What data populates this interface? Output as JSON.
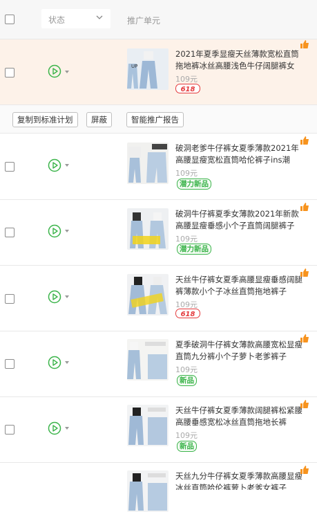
{
  "header": {
    "status_label": "状态",
    "unit_label": "推广单元"
  },
  "actions": {
    "copy_label": "复制到标准计划",
    "block_label": "屏蔽",
    "report_label": "智能推广报告"
  },
  "items": [
    {
      "title": "2021年夏季显瘦天丝薄款宽松直筒拖地裤冰丝高腰浅色牛仔阔腿裤女",
      "price": "109元",
      "badge": "618"
    },
    {
      "title": "破洞老爹牛仔裤女夏季薄款2021年高腰显瘦宽松直筒哈伦裤子ins潮",
      "price": "109元",
      "badge": "潜力新品"
    },
    {
      "title": "破洞牛仔裤夏季女薄款2021年新款高腰显瘦垂感小个子直筒阔腿裤子",
      "price": "109元",
      "badge": "潜力新品"
    },
    {
      "title": "天丝牛仔裤女夏季高腰显瘦垂感阔腿裤薄款小个子冰丝直筒拖地裤子",
      "price": "109元",
      "badge": "618"
    },
    {
      "title": "夏季破洞牛仔裤女薄款高腰宽松显瘦直筒九分裤小个子萝卜老爹裤子",
      "price": "109元",
      "badge": "新品"
    },
    {
      "title": "天丝牛仔裤女夏季薄款阔腿裤松紧腰高腰垂感宽松冰丝直筒拖地长裤",
      "price": "109元",
      "badge": "新品"
    },
    {
      "title": "天丝九分牛仔裤女夏季薄款高腰显瘦冰丝直筒哈伦裤萝卜老爹女裤子",
      "price": "",
      "badge": ""
    }
  ],
  "colors": {
    "accent_orange": "#f7931e",
    "play_green": "#3bb44a",
    "badge_red": "#e4393c",
    "selected_row": "#fdf2e9"
  }
}
